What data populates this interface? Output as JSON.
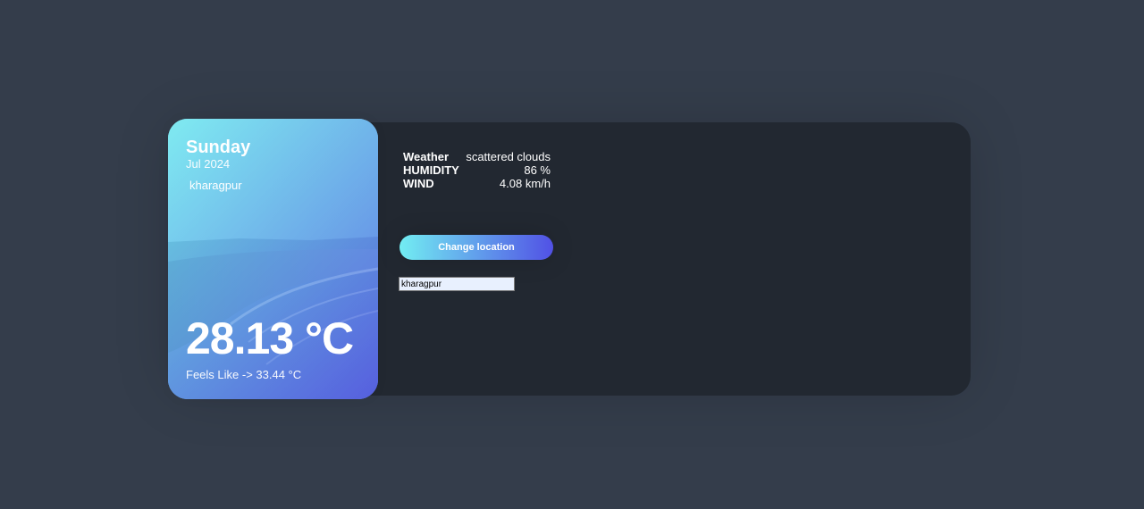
{
  "card": {
    "dayname": "Sunday",
    "date": "Jul 2024",
    "location": "kharagpur",
    "temperature": "28.13 °C",
    "feels_like": "Feels Like -> 33.44 °C"
  },
  "info": {
    "weather_title": "Weather",
    "weather_value": "scattered clouds",
    "humidity_title": "HUMIDITY",
    "humidity_value": "86 %",
    "wind_title": "WIND",
    "wind_value": "4.08 km/h"
  },
  "actions": {
    "change_location_label": "Change location",
    "location_input_value": "kharagpur"
  },
  "colors": {
    "background": "#343d4b",
    "panel": "#222831",
    "gradient_start": "#72edf2",
    "gradient_end": "#5151e5"
  }
}
